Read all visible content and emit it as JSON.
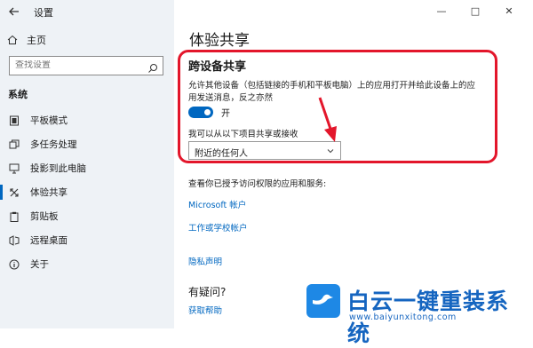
{
  "window": {
    "title": "设置",
    "controls": {
      "minimize": "—",
      "maximize": "□",
      "close": "✕"
    }
  },
  "sidebar": {
    "home": "主页",
    "search_placeholder": "查找设置",
    "section": "系统",
    "items": [
      {
        "label": "平板模式",
        "icon": "tablet-icon"
      },
      {
        "label": "多任务处理",
        "icon": "multitask-icon"
      },
      {
        "label": "投影到此电脑",
        "icon": "project-icon"
      },
      {
        "label": "体验共享",
        "icon": "share-icon",
        "active": true
      },
      {
        "label": "剪贴板",
        "icon": "clipboard-icon"
      },
      {
        "label": "远程桌面",
        "icon": "remote-desktop-icon"
      },
      {
        "label": "关于",
        "icon": "info-icon"
      }
    ]
  },
  "main": {
    "title": "体验共享",
    "section_title": "跨设备共享",
    "description": "允许其他设备（包括链接的手机和平板电脑）上的应用打开并给此设备上的应用发送消息，反之亦然",
    "toggle_label": "开",
    "toggle_on": true,
    "receive_label": "我可以从以下项目共享或接收",
    "dropdown_value": "附近的任何人",
    "permissions_text": "查看你已授予访问权限的应用和服务:",
    "links": {
      "microsoft_account": "Microsoft 帐户",
      "work_account": "工作或学校帐户",
      "privacy": "隐私声明"
    },
    "question_title": "有疑问?",
    "help_link": "获取帮助"
  },
  "watermark": {
    "text": "白云一键重装系统",
    "url": "www.baiyunxitong.com"
  },
  "colors": {
    "accent": "#0067c0",
    "highlight": "#e3162b",
    "sidebar_bg": "#eef2f6"
  }
}
